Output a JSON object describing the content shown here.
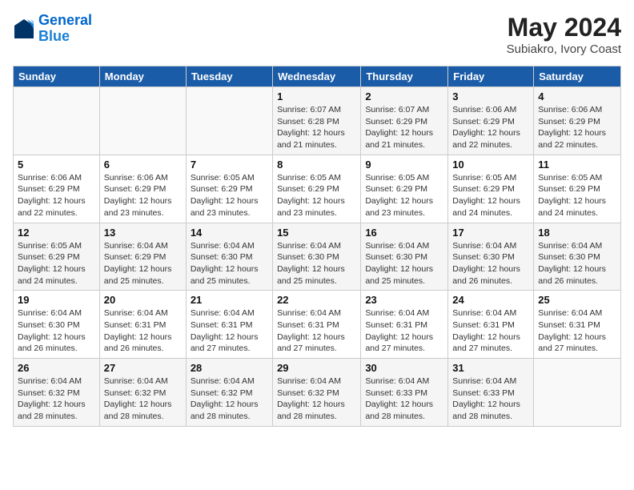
{
  "header": {
    "logo_line1": "General",
    "logo_line2": "Blue",
    "month_year": "May 2024",
    "location": "Subiakro, Ivory Coast"
  },
  "weekdays": [
    "Sunday",
    "Monday",
    "Tuesday",
    "Wednesday",
    "Thursday",
    "Friday",
    "Saturday"
  ],
  "weeks": [
    [
      {
        "day": "",
        "info": ""
      },
      {
        "day": "",
        "info": ""
      },
      {
        "day": "",
        "info": ""
      },
      {
        "day": "1",
        "info": "Sunrise: 6:07 AM\nSunset: 6:28 PM\nDaylight: 12 hours\nand 21 minutes."
      },
      {
        "day": "2",
        "info": "Sunrise: 6:07 AM\nSunset: 6:29 PM\nDaylight: 12 hours\nand 21 minutes."
      },
      {
        "day": "3",
        "info": "Sunrise: 6:06 AM\nSunset: 6:29 PM\nDaylight: 12 hours\nand 22 minutes."
      },
      {
        "day": "4",
        "info": "Sunrise: 6:06 AM\nSunset: 6:29 PM\nDaylight: 12 hours\nand 22 minutes."
      }
    ],
    [
      {
        "day": "5",
        "info": "Sunrise: 6:06 AM\nSunset: 6:29 PM\nDaylight: 12 hours\nand 22 minutes."
      },
      {
        "day": "6",
        "info": "Sunrise: 6:06 AM\nSunset: 6:29 PM\nDaylight: 12 hours\nand 23 minutes."
      },
      {
        "day": "7",
        "info": "Sunrise: 6:05 AM\nSunset: 6:29 PM\nDaylight: 12 hours\nand 23 minutes."
      },
      {
        "day": "8",
        "info": "Sunrise: 6:05 AM\nSunset: 6:29 PM\nDaylight: 12 hours\nand 23 minutes."
      },
      {
        "day": "9",
        "info": "Sunrise: 6:05 AM\nSunset: 6:29 PM\nDaylight: 12 hours\nand 23 minutes."
      },
      {
        "day": "10",
        "info": "Sunrise: 6:05 AM\nSunset: 6:29 PM\nDaylight: 12 hours\nand 24 minutes."
      },
      {
        "day": "11",
        "info": "Sunrise: 6:05 AM\nSunset: 6:29 PM\nDaylight: 12 hours\nand 24 minutes."
      }
    ],
    [
      {
        "day": "12",
        "info": "Sunrise: 6:05 AM\nSunset: 6:29 PM\nDaylight: 12 hours\nand 24 minutes."
      },
      {
        "day": "13",
        "info": "Sunrise: 6:04 AM\nSunset: 6:29 PM\nDaylight: 12 hours\nand 25 minutes."
      },
      {
        "day": "14",
        "info": "Sunrise: 6:04 AM\nSunset: 6:30 PM\nDaylight: 12 hours\nand 25 minutes."
      },
      {
        "day": "15",
        "info": "Sunrise: 6:04 AM\nSunset: 6:30 PM\nDaylight: 12 hours\nand 25 minutes."
      },
      {
        "day": "16",
        "info": "Sunrise: 6:04 AM\nSunset: 6:30 PM\nDaylight: 12 hours\nand 25 minutes."
      },
      {
        "day": "17",
        "info": "Sunrise: 6:04 AM\nSunset: 6:30 PM\nDaylight: 12 hours\nand 26 minutes."
      },
      {
        "day": "18",
        "info": "Sunrise: 6:04 AM\nSunset: 6:30 PM\nDaylight: 12 hours\nand 26 minutes."
      }
    ],
    [
      {
        "day": "19",
        "info": "Sunrise: 6:04 AM\nSunset: 6:30 PM\nDaylight: 12 hours\nand 26 minutes."
      },
      {
        "day": "20",
        "info": "Sunrise: 6:04 AM\nSunset: 6:31 PM\nDaylight: 12 hours\nand 26 minutes."
      },
      {
        "day": "21",
        "info": "Sunrise: 6:04 AM\nSunset: 6:31 PM\nDaylight: 12 hours\nand 27 minutes."
      },
      {
        "day": "22",
        "info": "Sunrise: 6:04 AM\nSunset: 6:31 PM\nDaylight: 12 hours\nand 27 minutes."
      },
      {
        "day": "23",
        "info": "Sunrise: 6:04 AM\nSunset: 6:31 PM\nDaylight: 12 hours\nand 27 minutes."
      },
      {
        "day": "24",
        "info": "Sunrise: 6:04 AM\nSunset: 6:31 PM\nDaylight: 12 hours\nand 27 minutes."
      },
      {
        "day": "25",
        "info": "Sunrise: 6:04 AM\nSunset: 6:31 PM\nDaylight: 12 hours\nand 27 minutes."
      }
    ],
    [
      {
        "day": "26",
        "info": "Sunrise: 6:04 AM\nSunset: 6:32 PM\nDaylight: 12 hours\nand 28 minutes."
      },
      {
        "day": "27",
        "info": "Sunrise: 6:04 AM\nSunset: 6:32 PM\nDaylight: 12 hours\nand 28 minutes."
      },
      {
        "day": "28",
        "info": "Sunrise: 6:04 AM\nSunset: 6:32 PM\nDaylight: 12 hours\nand 28 minutes."
      },
      {
        "day": "29",
        "info": "Sunrise: 6:04 AM\nSunset: 6:32 PM\nDaylight: 12 hours\nand 28 minutes."
      },
      {
        "day": "30",
        "info": "Sunrise: 6:04 AM\nSunset: 6:33 PM\nDaylight: 12 hours\nand 28 minutes."
      },
      {
        "day": "31",
        "info": "Sunrise: 6:04 AM\nSunset: 6:33 PM\nDaylight: 12 hours\nand 28 minutes."
      },
      {
        "day": "",
        "info": ""
      }
    ]
  ]
}
